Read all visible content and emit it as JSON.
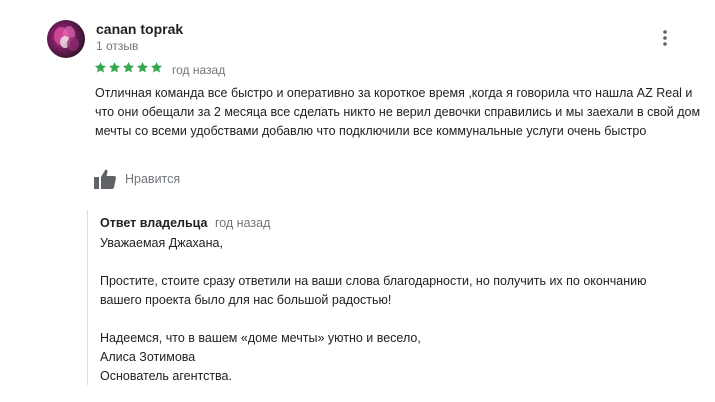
{
  "review": {
    "author_name": "canan toprak",
    "review_count": "1 отзыв",
    "rating": 5,
    "rating_max": 5,
    "date": "год назад",
    "text": "Отличная команда все быстро и оперативно за короткое время ,когда я говорила что нашла AZ Real и что они обещали за 2 месяца все сделать никто не верил девочки справились и мы заехали в свой  дом мечты со всеми удобствами добавлю что подключили все коммунальные услуги очень быстро",
    "like_label": "Нравится",
    "star_color": "#34a853",
    "avatar_icon": "avatar-photo"
  },
  "owner_reply": {
    "label": "Ответ владельца",
    "date": "год назад",
    "lines": {
      "greeting": "Уважаемая Джахана,",
      "body": "Простите, стоите сразу ответили на ваши слова благодарности, но получить их по окончанию вашего проекта было для нас большой радостью!",
      "wish": "Надеемся, что в вашем «доме мечты» уютно и весело,",
      "name": "Алиса Зотимова",
      "role": "Основатель агентства."
    }
  }
}
